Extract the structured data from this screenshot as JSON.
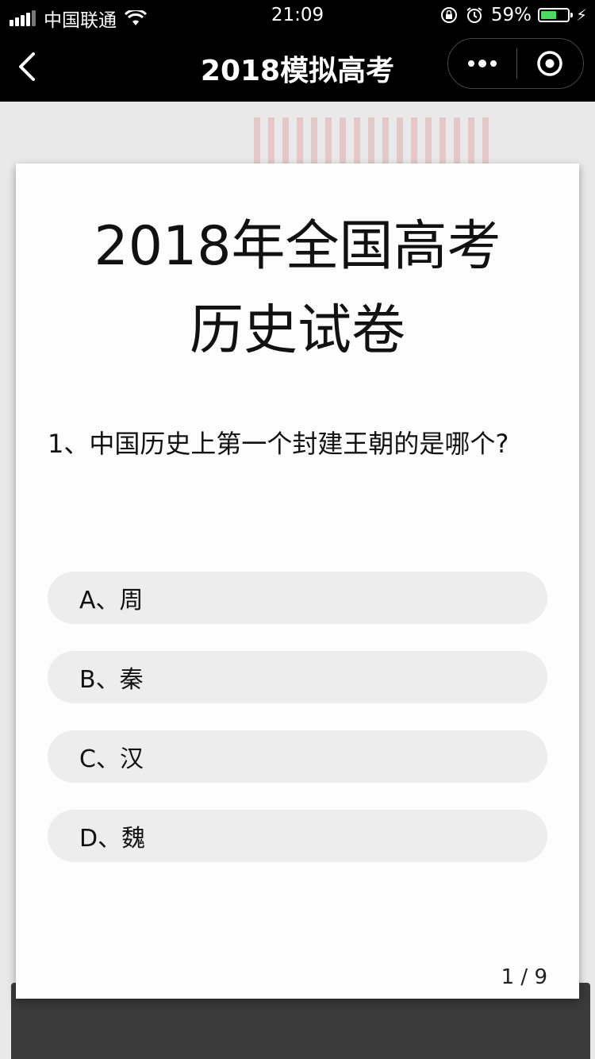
{
  "status_bar": {
    "carrier": "中国联通",
    "time": "21:09",
    "battery_percent": "59%",
    "battery_level": 0.59,
    "battery_color": "#4cd964"
  },
  "nav": {
    "title": "2018模拟高考",
    "back_icon": "chevron-left-icon",
    "more_icon": "more-dots-icon",
    "close_icon": "target-circle-icon"
  },
  "exam": {
    "title_line1": "2018年全国高考",
    "title_line2": "历史试卷",
    "question": "1、中国历史上第一个封建王朝的是哪个?",
    "options": [
      {
        "label": "A、周"
      },
      {
        "label": "B、秦"
      },
      {
        "label": "C、汉"
      },
      {
        "label": "D、魏"
      }
    ],
    "page_counter": "1 / 9"
  }
}
